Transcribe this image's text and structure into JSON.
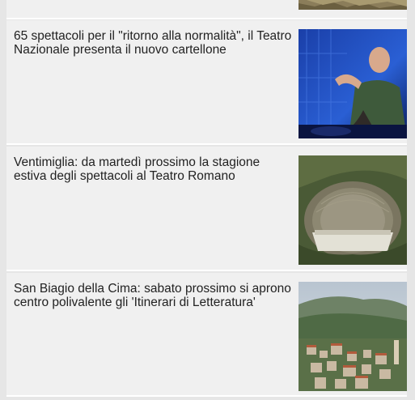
{
  "articles": [
    {
      "title": ""
    },
    {
      "title": "65 spettacoli per il \"ritorno alla normalità\", il Teatro Nazionale presenta il nuovo cartellone",
      "image": "actor-on-stage-photo"
    },
    {
      "title": "Ventimiglia: da martedì prossimo la stagione estiva degli spettacoli al Teatro Romano",
      "image": "roman-theatre-photo"
    },
    {
      "title": "San Biagio della Cima: sabato prossimo si aprono centro polivalente gli 'Itinerari di Letteratura'",
      "image": "hill-village-photo"
    }
  ]
}
